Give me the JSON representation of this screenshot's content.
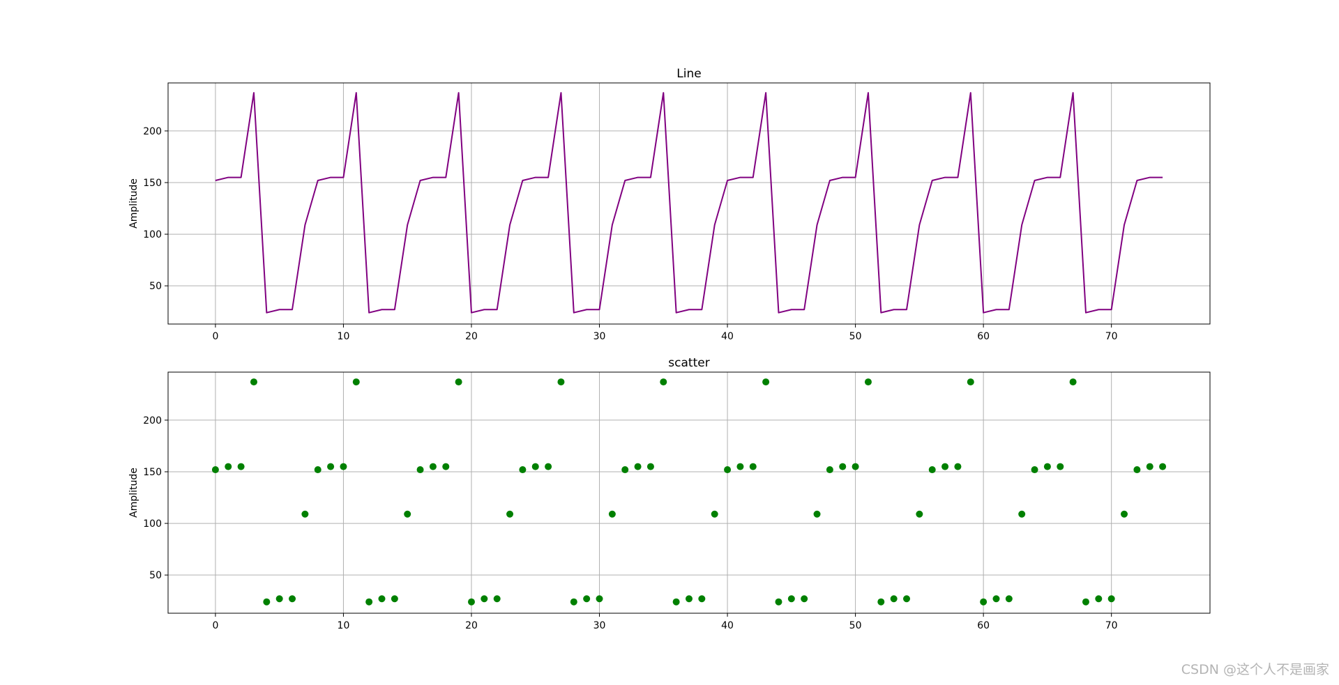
{
  "watermark": "CSDN @这个人不是画家",
  "chart_data": [
    {
      "type": "line",
      "title": "Line",
      "xlabel": "",
      "ylabel": "Amplitude",
      "color": "#800080",
      "xlim": [
        -3.7,
        77.7
      ],
      "ylim": [
        13,
        246.5
      ],
      "xticks": [
        0,
        10,
        20,
        30,
        40,
        50,
        60,
        70
      ],
      "yticks": [
        50,
        100,
        150,
        200
      ],
      "grid": true,
      "x": [
        0,
        1,
        2,
        3,
        4,
        5,
        6,
        7,
        8,
        9,
        10,
        11,
        12,
        13,
        14,
        15,
        16,
        17,
        18,
        19,
        20,
        21,
        22,
        23,
        24,
        25,
        26,
        27,
        28,
        29,
        30,
        31,
        32,
        33,
        34,
        35,
        36,
        37,
        38,
        39,
        40,
        41,
        42,
        43,
        44,
        45,
        46,
        47,
        48,
        49,
        50,
        51,
        52,
        53,
        54,
        55,
        56,
        57,
        58,
        59,
        60,
        61,
        62,
        63,
        64,
        65,
        66,
        67,
        68,
        69,
        70,
        71,
        72,
        73,
        74
      ],
      "y": [
        152,
        155,
        155,
        237,
        24,
        27,
        27,
        109,
        152,
        155,
        155,
        237,
        24,
        27,
        27,
        109,
        152,
        155,
        155,
        237,
        24,
        27,
        27,
        109,
        152,
        155,
        155,
        237,
        24,
        27,
        27,
        109,
        152,
        155,
        155,
        237,
        24,
        27,
        27,
        109,
        152,
        155,
        155,
        237,
        24,
        27,
        27,
        109,
        152,
        155,
        155,
        237,
        24,
        27,
        27,
        109,
        152,
        155,
        155,
        237,
        24,
        27,
        27,
        109,
        152,
        155,
        155,
        237,
        24,
        27,
        27,
        109,
        152,
        155,
        155
      ]
    },
    {
      "type": "scatter",
      "title": "scatter",
      "xlabel": "",
      "ylabel": "Amplitude",
      "color": "#008000",
      "xlim": [
        -3.7,
        77.7
      ],
      "ylim": [
        13,
        246.5
      ],
      "xticks": [
        0,
        10,
        20,
        30,
        40,
        50,
        60,
        70
      ],
      "yticks": [
        50,
        100,
        150,
        200
      ],
      "grid": true,
      "x": [
        0,
        1,
        2,
        3,
        4,
        5,
        6,
        7,
        8,
        9,
        10,
        11,
        12,
        13,
        14,
        15,
        16,
        17,
        18,
        19,
        20,
        21,
        22,
        23,
        24,
        25,
        26,
        27,
        28,
        29,
        30,
        31,
        32,
        33,
        34,
        35,
        36,
        37,
        38,
        39,
        40,
        41,
        42,
        43,
        44,
        45,
        46,
        47,
        48,
        49,
        50,
        51,
        52,
        53,
        54,
        55,
        56,
        57,
        58,
        59,
        60,
        61,
        62,
        63,
        64,
        65,
        66,
        67,
        68,
        69,
        70,
        71,
        72,
        73,
        74
      ],
      "y": [
        152,
        155,
        155,
        237,
        24,
        27,
        27,
        109,
        152,
        155,
        155,
        237,
        24,
        27,
        27,
        109,
        152,
        155,
        155,
        237,
        24,
        27,
        27,
        109,
        152,
        155,
        155,
        237,
        24,
        27,
        27,
        109,
        152,
        155,
        155,
        237,
        24,
        27,
        27,
        109,
        152,
        155,
        155,
        237,
        24,
        27,
        27,
        109,
        152,
        155,
        155,
        237,
        24,
        27,
        27,
        109,
        152,
        155,
        155,
        237,
        24,
        27,
        27,
        109,
        152,
        155,
        155,
        237,
        24,
        27,
        27,
        109,
        152,
        155,
        155
      ]
    }
  ]
}
